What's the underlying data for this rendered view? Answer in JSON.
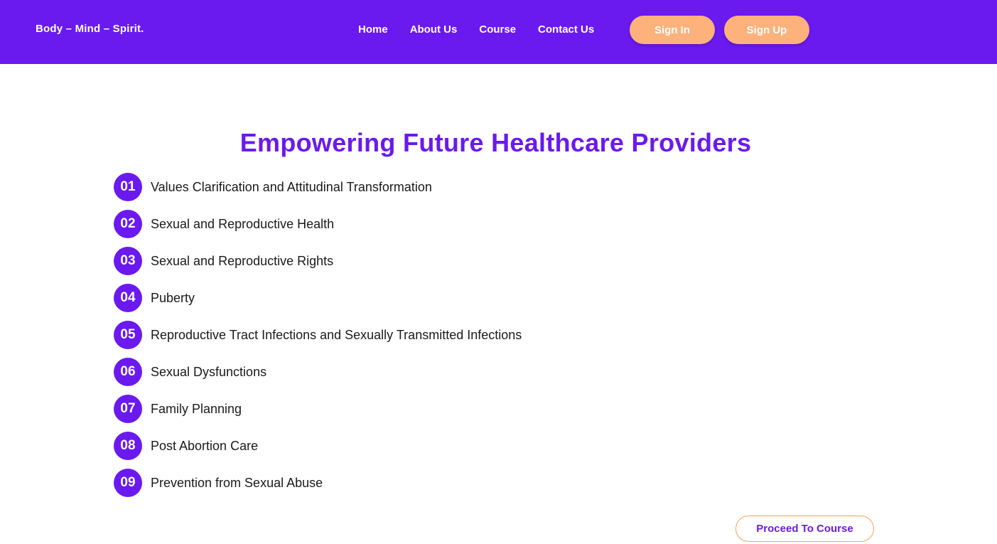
{
  "header": {
    "brand": "Body – Mind – Spirit.",
    "nav": [
      "Home",
      "About Us",
      "Course",
      "Contact Us"
    ],
    "sign_in": "Sign In",
    "sign_up": "Sign Up"
  },
  "main": {
    "title": "Empowering Future Healthcare Providers",
    "topics": [
      {
        "num": "01",
        "label": "Values Clarification and Attitudinal Transformation"
      },
      {
        "num": "02",
        "label": "Sexual and Reproductive Health"
      },
      {
        "num": "03",
        "label": "Sexual and Reproductive Rights"
      },
      {
        "num": "04",
        "label": "Puberty"
      },
      {
        "num": "05",
        "label": "Reproductive Tract Infections and Sexually Transmitted Infections"
      },
      {
        "num": "06",
        "label": "Sexual Dysfunctions"
      },
      {
        "num": "07",
        "label": "Family Planning"
      },
      {
        "num": "08",
        "label": "Post Abortion Care"
      },
      {
        "num": "09",
        "label": "Prevention from Sexual Abuse"
      }
    ],
    "proceed": "Proceed To Course"
  },
  "colors": {
    "brand_purple": "#6a1aef",
    "accent_peach": "#fdb27c",
    "proceed_border": "#f5a25d"
  }
}
